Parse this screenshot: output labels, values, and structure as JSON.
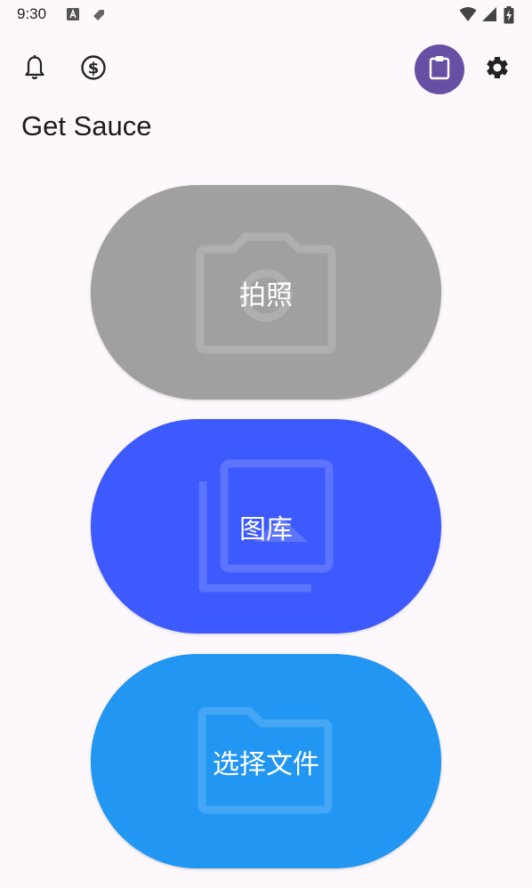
{
  "status_bar": {
    "time": "9:30",
    "left_icons": [
      "text-a-icon",
      "tag-icon"
    ],
    "right_icons": [
      "wifi-icon",
      "signal-icon",
      "battery-charging-icon"
    ]
  },
  "toolbar": {
    "left_icons": [
      "bell-icon",
      "dollar-circle-icon"
    ],
    "right_icons": [
      "clipboard-icon",
      "gear-icon"
    ],
    "accent_color": "#6750a4"
  },
  "page": {
    "title": "Get Sauce"
  },
  "actions": [
    {
      "label": "拍照",
      "icon": "camera-icon",
      "color": "#a0a0a0"
    },
    {
      "label": "图库",
      "icon": "photo-library-icon",
      "color": "#3d5afe"
    },
    {
      "label": "选择文件",
      "icon": "folder-icon",
      "color": "#2196f3"
    }
  ]
}
